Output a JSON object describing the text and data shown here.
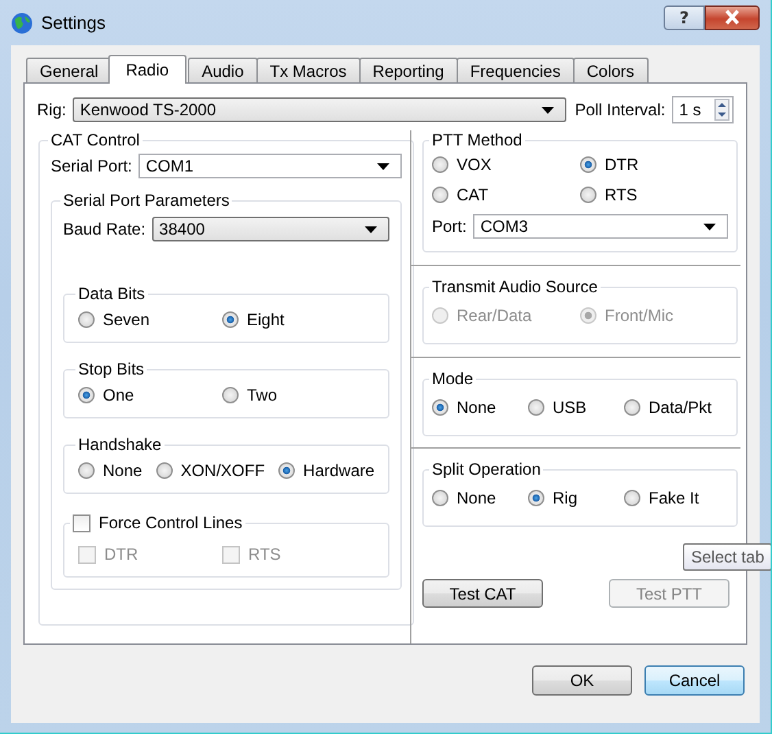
{
  "window": {
    "title": "Settings",
    "help_button": "?"
  },
  "tabs": [
    {
      "label": "General",
      "selected": false
    },
    {
      "label": "Radio",
      "selected": true
    },
    {
      "label": "Audio",
      "selected": false
    },
    {
      "label": "Tx Macros",
      "selected": false
    },
    {
      "label": "Reporting",
      "selected": false
    },
    {
      "label": "Frequencies",
      "selected": false
    },
    {
      "label": "Colors",
      "selected": false
    }
  ],
  "rig": {
    "label": "Rig:",
    "value": "Kenwood TS-2000"
  },
  "poll_interval": {
    "label": "Poll Interval:",
    "value": "1 s"
  },
  "cat_control": {
    "title": "CAT Control",
    "serial_port": {
      "label": "Serial Port:",
      "value": "COM1"
    },
    "serial_port_parameters": {
      "title": "Serial Port Parameters",
      "baud_rate": {
        "label": "Baud Rate:",
        "value": "38400"
      },
      "data_bits": {
        "title": "Data Bits",
        "options": [
          {
            "label": "Seven",
            "selected": false
          },
          {
            "label": "Eight",
            "selected": true
          }
        ]
      },
      "stop_bits": {
        "title": "Stop Bits",
        "options": [
          {
            "label": "One",
            "selected": true
          },
          {
            "label": "Two",
            "selected": false
          }
        ]
      },
      "handshake": {
        "title": "Handshake",
        "options": [
          {
            "label": "None",
            "selected": false
          },
          {
            "label": "XON/XOFF",
            "selected": false
          },
          {
            "label": "Hardware",
            "selected": true
          }
        ]
      },
      "force_control_lines": {
        "label": "Force Control Lines",
        "checked": false,
        "lines": [
          {
            "label": "DTR",
            "checked": false,
            "disabled": true
          },
          {
            "label": "RTS",
            "checked": false,
            "disabled": true
          }
        ]
      }
    }
  },
  "ptt_method": {
    "title": "PTT Method",
    "options": [
      {
        "label": "VOX",
        "selected": false
      },
      {
        "label": "DTR",
        "selected": true
      },
      {
        "label": "CAT",
        "selected": false
      },
      {
        "label": "RTS",
        "selected": false
      }
    ],
    "port": {
      "label": "Port:",
      "value": "COM3"
    }
  },
  "transmit_audio_source": {
    "title": "Transmit Audio Source",
    "disabled": true,
    "options": [
      {
        "label": "Rear/Data",
        "selected": false
      },
      {
        "label": "Front/Mic",
        "selected": true
      }
    ]
  },
  "mode": {
    "title": "Mode",
    "options": [
      {
        "label": "None",
        "selected": true
      },
      {
        "label": "USB",
        "selected": false
      },
      {
        "label": "Data/Pkt",
        "selected": false
      }
    ]
  },
  "split_operation": {
    "title": "Split Operation",
    "options": [
      {
        "label": "None",
        "selected": false
      },
      {
        "label": "Rig",
        "selected": true
      },
      {
        "label": "Fake It",
        "selected": false
      }
    ]
  },
  "test_cat": {
    "label": "Test CAT",
    "disabled": false
  },
  "test_ptt": {
    "label": "Test PTT",
    "disabled": true
  },
  "tooltip": "Select tab",
  "dialog_buttons": [
    {
      "label": "OK",
      "focused": false
    },
    {
      "label": "Cancel",
      "focused": true
    }
  ]
}
